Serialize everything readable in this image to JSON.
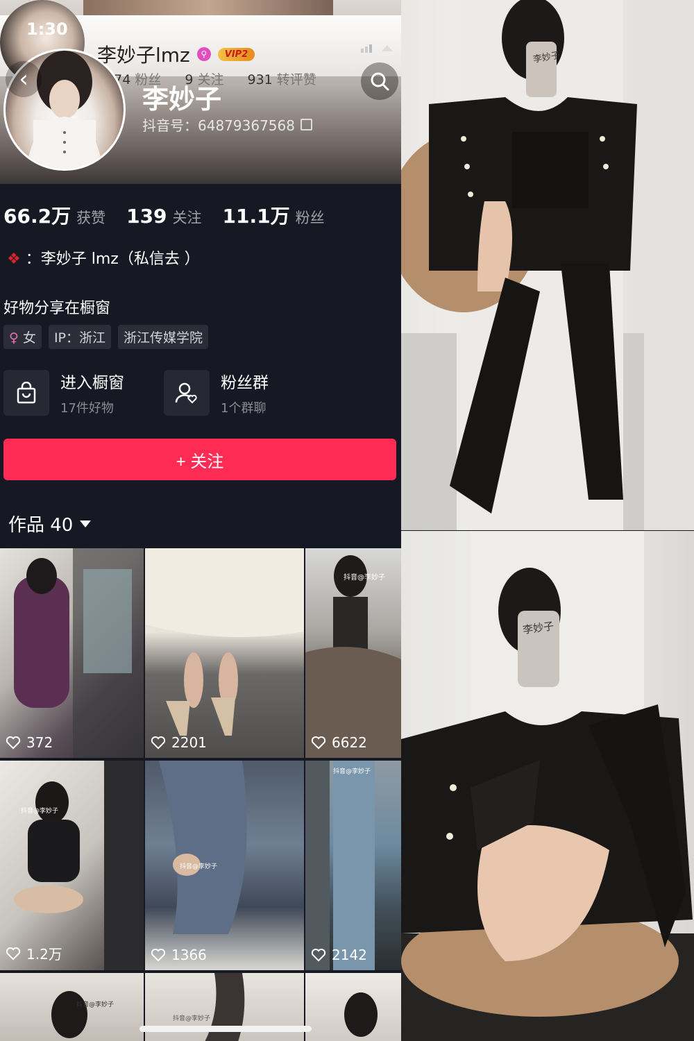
{
  "status_bar": {
    "time": "1:30"
  },
  "sticky_header": {
    "name": "李妙子lmz",
    "vip": "VIP2",
    "stats": [
      {
        "value": "2474",
        "label": "粉丝"
      },
      {
        "value": "9",
        "label": "关注"
      },
      {
        "value": "931",
        "label": "转评赞"
      }
    ]
  },
  "profile": {
    "nickname": "李妙子",
    "douyin_id": "抖音号：64879367568",
    "stats": [
      {
        "value": "66.2万",
        "label": "获赞"
      },
      {
        "value": "139",
        "label": "关注"
      },
      {
        "value": "11.1万",
        "label": "粉丝"
      }
    ],
    "bio_line1": "：李妙子 lmz（私信去 ）",
    "bio_line2": "好物分享在橱窗",
    "tags": {
      "gender": "女",
      "ip": "IP：浙江",
      "school": "浙江传媒学院"
    },
    "shop": {
      "title": "进入橱窗",
      "sub": "17件好物"
    },
    "fan_group": {
      "title": "粉丝群",
      "sub": "1个群聊"
    },
    "follow_label": "+ 关注",
    "works_label": "作品 40"
  },
  "videos": [
    {
      "likes": "372"
    },
    {
      "likes": "2201"
    },
    {
      "likes": "6622"
    },
    {
      "likes": "1.2万"
    },
    {
      "likes": "1366"
    },
    {
      "likes": "2142"
    }
  ],
  "watermarks": {
    "phone_case": "李妙子",
    "video": "抖音@李妙子"
  },
  "colors": {
    "accent": "#fe2c55",
    "background": "#161823"
  },
  "icons": [
    "back-icon",
    "search-icon",
    "shopping-bag-icon",
    "group-icon",
    "heart-icon",
    "copy-icon",
    "female-icon"
  ]
}
